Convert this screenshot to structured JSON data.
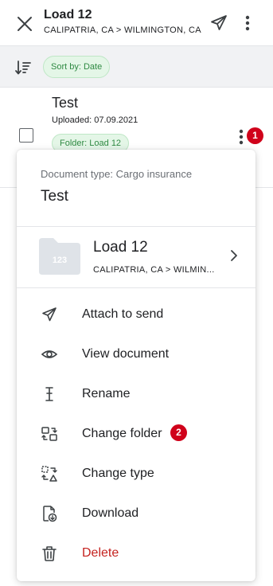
{
  "header": {
    "title": "Load 12",
    "subtitle": "CALIPATRIA, CA > WILMINGTON, CA",
    "icons": [
      "close-icon",
      "send-icon",
      "more-vertical-icon"
    ]
  },
  "toolbar": {
    "sort_chip": "Sort by: Date",
    "icons": [
      "sort-icon"
    ]
  },
  "document": {
    "title": "Test",
    "uploaded": "Uploaded: 07.09.2021",
    "folder_chip": "Folder: Load 12",
    "badge": "1"
  },
  "menu": {
    "doc_type": "Document type: Cargo insurance",
    "doc_title": "Test",
    "folder": {
      "thumb_label": "123",
      "name": "Load 12",
      "route": "CALIPATRIA, CA > WILMIN..."
    },
    "items": [
      {
        "label": "Attach to send",
        "icon": "send-icon"
      },
      {
        "label": "View document",
        "icon": "eye-icon"
      },
      {
        "label": "Rename",
        "icon": "text-cursor-icon"
      },
      {
        "label": "Change folder",
        "icon": "change-folder-icon"
      },
      {
        "label": "Change type",
        "icon": "change-type-icon"
      },
      {
        "label": "Download",
        "icon": "download-icon"
      },
      {
        "label": "Delete",
        "icon": "trash-icon"
      }
    ],
    "badge": "2"
  },
  "colors": {
    "accent_green": "#2f8a43",
    "chip_bg": "#e4f6e7",
    "danger": "#c5221f",
    "badge_red": "#d0021b"
  }
}
